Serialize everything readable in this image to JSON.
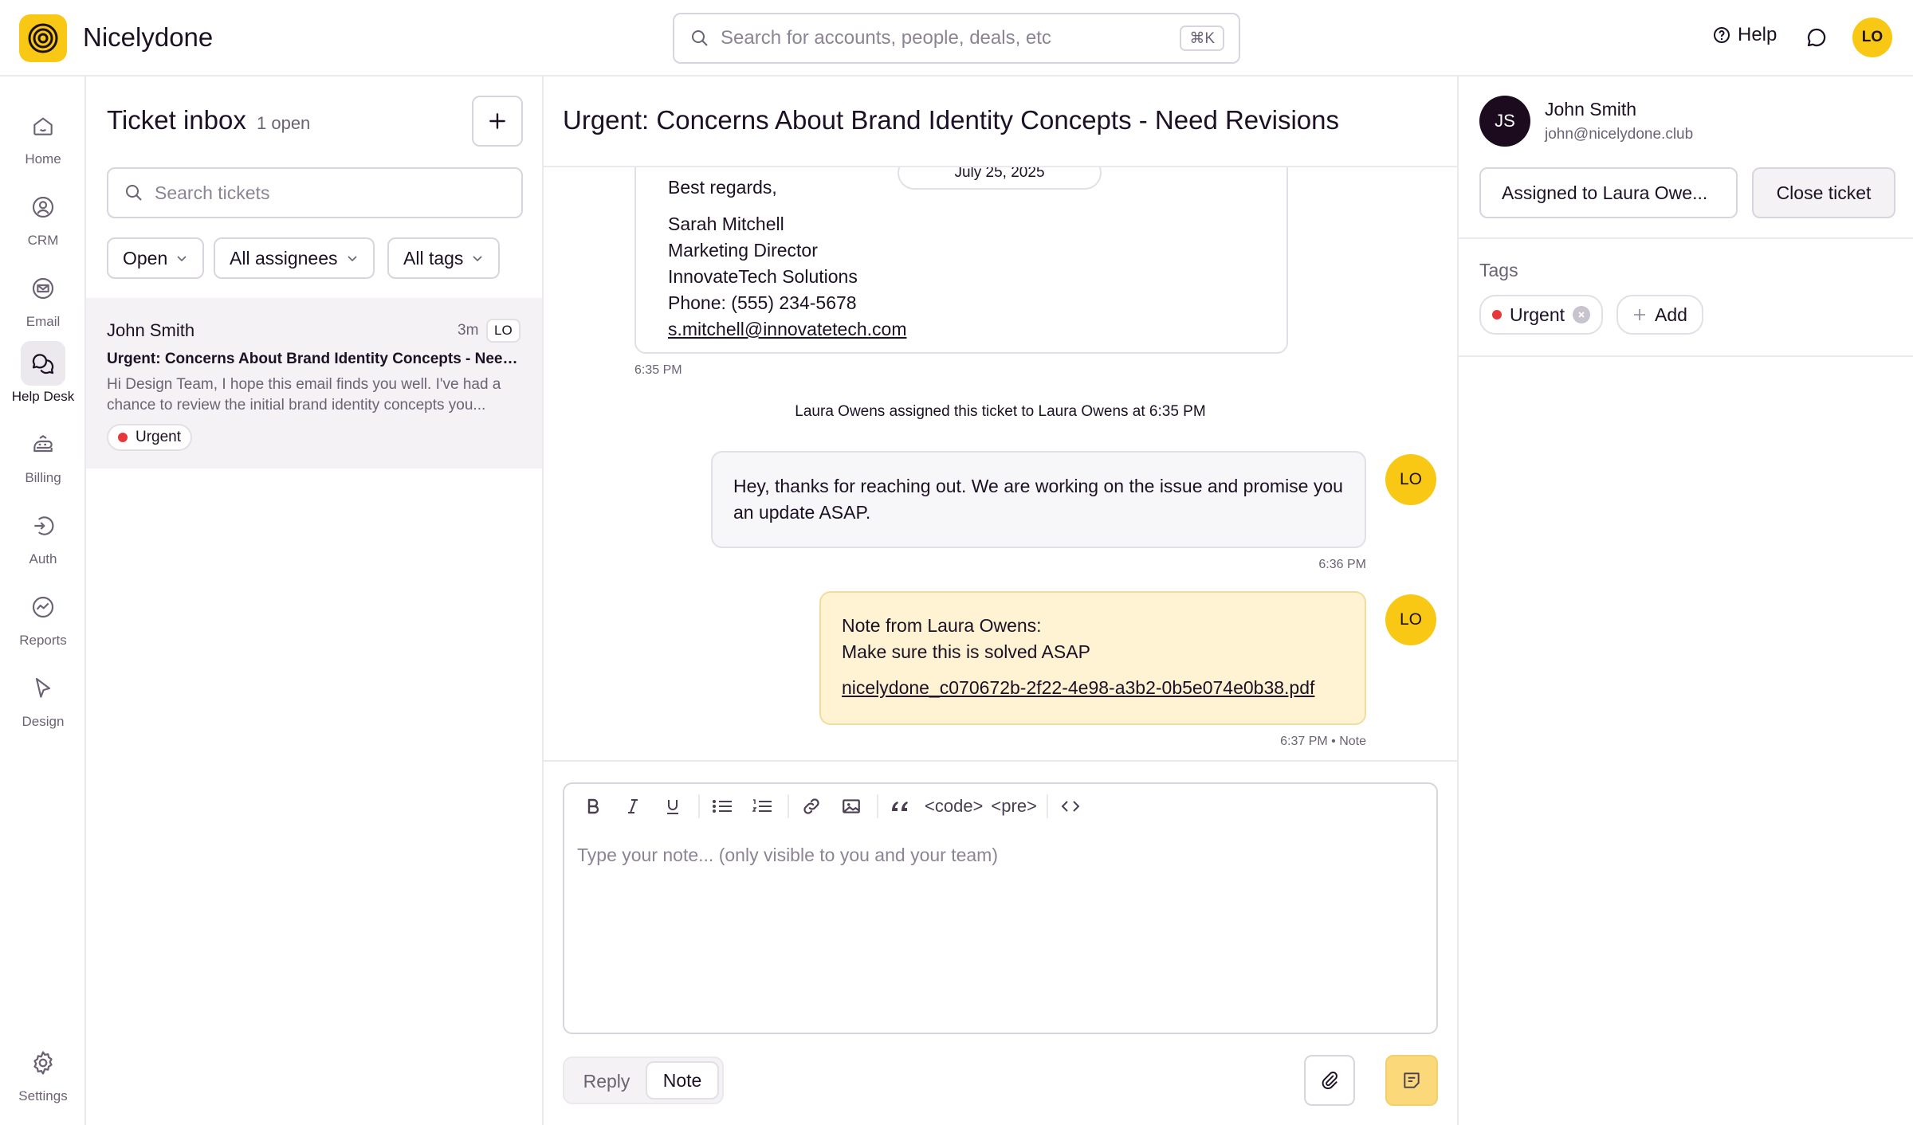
{
  "app": {
    "name": "Nicelydone",
    "accent": "#f8c814"
  },
  "search": {
    "placeholder": "Search for accounts, people, deals, etc",
    "shortcut": "⌘K"
  },
  "header": {
    "help_label": "Help",
    "user_initials": "LO"
  },
  "nav": {
    "items": [
      {
        "label": "Home",
        "icon": "home-icon"
      },
      {
        "label": "CRM",
        "icon": "contact-icon"
      },
      {
        "label": "Email",
        "icon": "email-icon"
      },
      {
        "label": "Help Desk",
        "icon": "help-desk-icon",
        "active": true
      },
      {
        "label": "Billing",
        "icon": "billing-icon"
      },
      {
        "label": "Auth",
        "icon": "auth-icon"
      },
      {
        "label": "Reports",
        "icon": "reports-icon"
      },
      {
        "label": "Design",
        "icon": "design-icon"
      }
    ],
    "settings_label": "Settings"
  },
  "inbox": {
    "title": "Ticket inbox",
    "count": "1 open",
    "search_placeholder": "Search tickets",
    "filters": [
      "Open",
      "All assignees",
      "All tags"
    ],
    "tickets": [
      {
        "name": "John Smith",
        "time": "3m",
        "assignee": "LO",
        "subject": "Urgent: Concerns About Brand Identity Concepts - Need Revisions",
        "snippet": "Hi Design Team, I hope this email finds you well. I've had a chance to review the initial brand identity concepts you...",
        "tag": "Urgent"
      }
    ]
  },
  "conversation": {
    "title": "Urgent: Concerns About Brand Identity Concepts - Need Revisions",
    "date": "July 25, 2025",
    "email": {
      "lines": [
        "Best regards,",
        "Sarah Mitchell",
        "Marketing Director",
        "InnovateTech Solutions",
        "Phone: (555) 234-5678"
      ],
      "email_link": "s.mitchell@innovatetech.com",
      "time": "6:35 PM"
    },
    "system_message": "Laura Owens assigned this ticket to Laura Owens at 6:35 PM",
    "reply": {
      "text": "Hey, thanks for reaching out. We are working on the issue and promise you an update ASAP.",
      "time": "6:36 PM",
      "initials": "LO"
    },
    "note": {
      "heading": "Note from Laura Owens:",
      "text": "Make sure this is solved ASAP",
      "attachment": "nicelydone_c070672b-2f22-4e98-a3b2-0b5e074e0b38.pdf",
      "meta": "6:37 PM • Note",
      "initials": "LO"
    }
  },
  "composer": {
    "toolbar": {
      "code": "<code>",
      "pre": "<pre>",
      "source": "<>"
    },
    "placeholder": "Type your note... (only visible to you and your team)",
    "modes": [
      "Reply",
      "Note"
    ],
    "active_mode": "Note"
  },
  "contact": {
    "initials": "JS",
    "name": "John Smith",
    "email": "john@nicelydone.club",
    "assigned_label": "Assigned to Laura Owe...",
    "close_label": "Close ticket",
    "tags_label": "Tags",
    "tags": [
      "Urgent"
    ],
    "add_tag_label": "Add"
  }
}
